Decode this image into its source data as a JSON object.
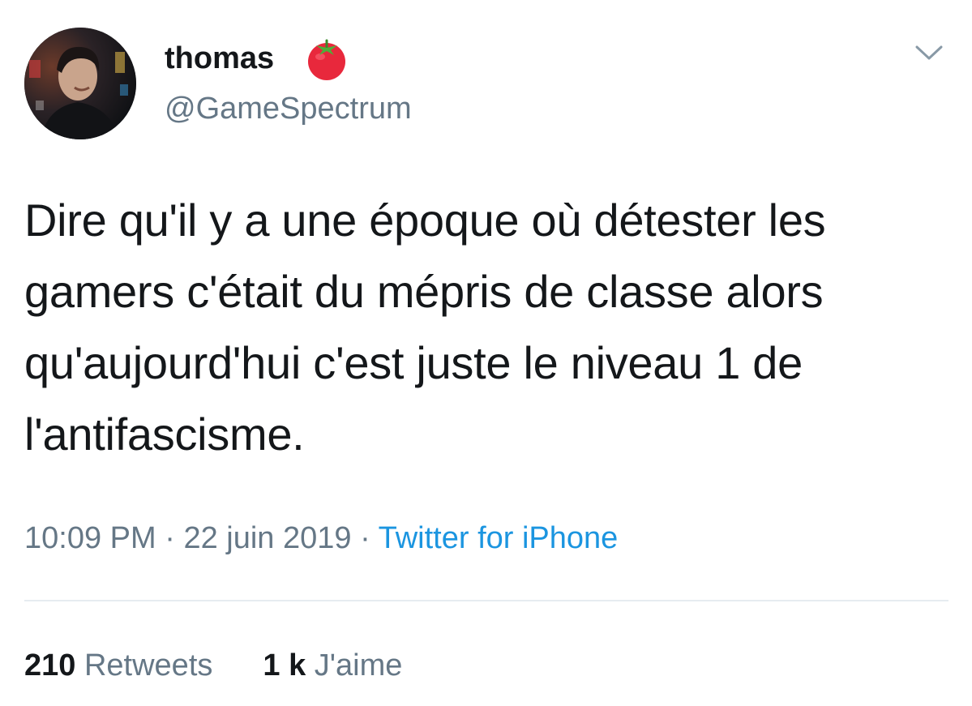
{
  "user": {
    "display_name": "thomas",
    "handle": "@GameSpectrum",
    "badge_icon": "tomato-emoji",
    "avatar": "profile-photo"
  },
  "menu_icon": "chevron-down-icon",
  "tweet": {
    "text": "Dire qu'il y a une époque où détester les gamers c'était du mépris de classe alors qu'aujourd'hui c'est juste le niveau 1 de l'antifascisme.",
    "time": "10:09 PM",
    "separator": " · ",
    "date": "22 juin 2019",
    "source": "Twitter for iPhone"
  },
  "stats": {
    "retweets_count": "210",
    "retweets_label": "Retweets",
    "likes_count": "1 k",
    "likes_label": "J'aime"
  },
  "colors": {
    "text": "#14171a",
    "secondary": "#657786",
    "link": "#1b95e0",
    "divider": "#e6ecf0",
    "tomato": "#e8283c"
  }
}
